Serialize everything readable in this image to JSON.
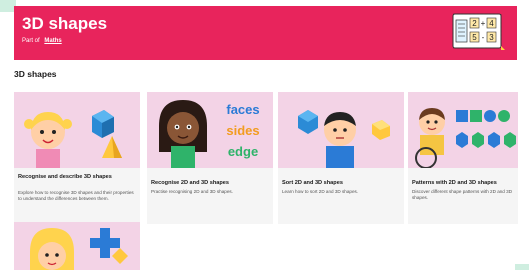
{
  "header": {
    "title": "3D shapes",
    "part_of_prefix": "Part of",
    "part_of_link": "Maths",
    "math_tiles": [
      "2",
      "4",
      "5",
      "3"
    ]
  },
  "section": {
    "title": "3D shapes"
  },
  "cards": [
    {
      "title": "Recognise and describe 3D shapes",
      "desc": "Explore how to recognise 3D shapes and their properties to understand the differences between them."
    },
    {
      "title": "Recognise 2D and 3D shapes",
      "desc": "Practise recognising 2D and 3D shapes.",
      "words": [
        "faces",
        "sides",
        "edge"
      ]
    },
    {
      "title": "Sort 2D and 3D shapes",
      "desc": "Learn how to sort 2D and 3D shapes."
    },
    {
      "title": "Patterns with 2D and 3D shapes",
      "desc": "Discover different shape patterns with 2D and 3D shapes."
    },
    {
      "title": "",
      "desc": ""
    }
  ],
  "colors": {
    "banner": "#e8245c",
    "card_thumb": "#f3d3e6",
    "accent_mint": "#cfeee0"
  }
}
